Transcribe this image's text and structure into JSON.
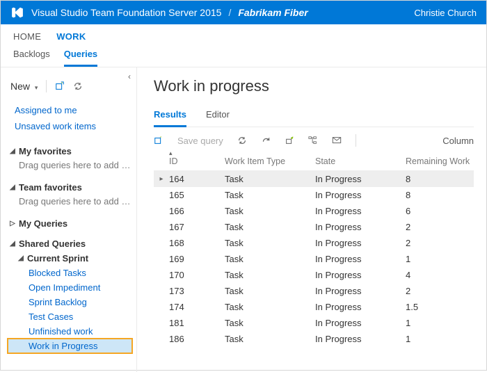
{
  "header": {
    "product": "Visual Studio Team Foundation Server 2015",
    "project": "Fabrikam Fiber",
    "user": "Christie Church"
  },
  "hubs": {
    "home": "HOME",
    "work": "WORK"
  },
  "subhubs": {
    "backlogs": "Backlogs",
    "queries": "Queries"
  },
  "sidebar": {
    "new_label": "New",
    "quick": {
      "assigned": "Assigned to me",
      "unsaved": "Unsaved work items"
    },
    "my_favorites": {
      "label": "My favorites",
      "placeholder": "Drag queries here to add t..."
    },
    "team_favorites": {
      "label": "Team favorites",
      "placeholder": "Drag queries here to add t..."
    },
    "my_queries": {
      "label": "My Queries"
    },
    "shared_queries": {
      "label": "Shared Queries"
    },
    "current_sprint": {
      "label": "Current Sprint"
    },
    "items": {
      "blocked": "Blocked Tasks",
      "open_imp": "Open Impediment",
      "sprint_backlog": "Sprint Backlog",
      "test_cases": "Test Cases",
      "unfinished": "Unfinished work",
      "wip": "Work in Progress"
    }
  },
  "content": {
    "title": "Work in progress",
    "tabs": {
      "results": "Results",
      "editor": "Editor"
    },
    "toolbar": {
      "save": "Save query",
      "column": "Column"
    },
    "columns": {
      "id": "ID",
      "type": "Work Item Type",
      "state": "State",
      "remaining": "Remaining Work"
    },
    "rows": [
      {
        "id": "164",
        "type": "Task",
        "state": "In Progress",
        "remaining": "8"
      },
      {
        "id": "165",
        "type": "Task",
        "state": "In Progress",
        "remaining": "8"
      },
      {
        "id": "166",
        "type": "Task",
        "state": "In Progress",
        "remaining": "6"
      },
      {
        "id": "167",
        "type": "Task",
        "state": "In Progress",
        "remaining": "2"
      },
      {
        "id": "168",
        "type": "Task",
        "state": "In Progress",
        "remaining": "2"
      },
      {
        "id": "169",
        "type": "Task",
        "state": "In Progress",
        "remaining": "1"
      },
      {
        "id": "170",
        "type": "Task",
        "state": "In Progress",
        "remaining": "4"
      },
      {
        "id": "173",
        "type": "Task",
        "state": "In Progress",
        "remaining": "2"
      },
      {
        "id": "174",
        "type": "Task",
        "state": "In Progress",
        "remaining": "1.5"
      },
      {
        "id": "181",
        "type": "Task",
        "state": "In Progress",
        "remaining": "1"
      },
      {
        "id": "186",
        "type": "Task",
        "state": "In Progress",
        "remaining": "1"
      }
    ]
  }
}
